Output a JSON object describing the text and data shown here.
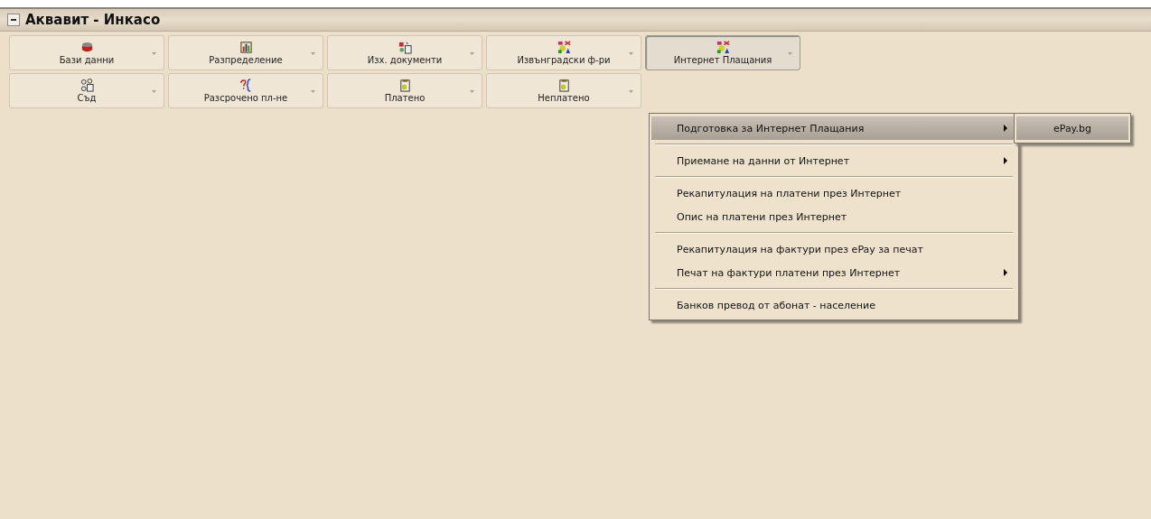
{
  "window": {
    "title": "Аквавит  - Инкасо"
  },
  "toolbar_rows": [
    [
      {
        "label": "Бази данни",
        "selected": false
      },
      {
        "label": "Разпределение",
        "selected": false
      },
      {
        "label": "Изх. документи",
        "selected": false
      },
      {
        "label": "Извънградски ф-ри",
        "selected": false
      },
      {
        "label": "Интернет Плащания",
        "selected": true
      }
    ],
    [
      {
        "label": "Съд",
        "selected": false
      },
      {
        "label": "Разсрочено пл-не",
        "selected": false
      },
      {
        "label": "Платено",
        "selected": false
      },
      {
        "label": "Неплатено",
        "selected": false
      }
    ]
  ],
  "menu": {
    "groups": [
      [
        {
          "label": "Подготовка за Интернет Плащания",
          "has_submenu": true,
          "selected": true
        }
      ],
      [
        {
          "label": "Приемане на данни от Интернет",
          "has_submenu": true,
          "selected": false
        }
      ],
      [
        {
          "label": "Рекапитулация на платени през Интернет",
          "has_submenu": false,
          "selected": false
        },
        {
          "label": "Опис на платени през Интернет",
          "has_submenu": false,
          "selected": false
        }
      ],
      [
        {
          "label": "Рекапитулация на фактури през ePay за печат",
          "has_submenu": false,
          "selected": false
        },
        {
          "label": "Печат на фактури платени през Интернет",
          "has_submenu": true,
          "selected": false
        }
      ],
      [
        {
          "label": "Банков превод от абонат - население",
          "has_submenu": false,
          "selected": false
        }
      ]
    ]
  },
  "submenu": {
    "items": [
      {
        "label": "ePay.bg",
        "selected": true
      }
    ]
  }
}
